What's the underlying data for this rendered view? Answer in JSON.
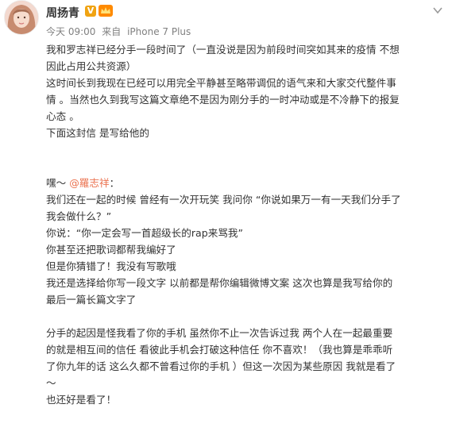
{
  "user": {
    "name": "周扬青",
    "verified_badge": "V",
    "avatar": "avatar-photo"
  },
  "meta": {
    "time": "今天 09:00",
    "source_prefix": "来自",
    "source": "iPhone 7 Plus"
  },
  "lines": [
    "我和罗志祥已经分手一段时间了（一直没说是因为前段时间突如其来的疫情 不想",
    "因此占用公共资源）",
    "这时间长到我现在已经可以用完全平静甚至略带调侃的语气来和大家交代整件事",
    "情 。当然也久到我写这篇文章绝不是因为刚分手的一时冲动或是不冷静下的报复",
    "心态 。",
    "下面这封信 是写给他的",
    "",
    "",
    "我们还在一起的时候 曾经有一次开玩笑 我问你 “你说如果万一有一天我们分手了",
    "我会做什么？”",
    "你说：“你一定会写一首超级长的rap来骂我”",
    "你甚至还把歌词都帮我编好了",
    "但是你猜错了！我没有写歌哦",
    "我还是选择给你写一段文字 以前都是帮你编辑微博文案 这次也算是我写给你的",
    "最后一篇长篇文字了",
    "",
    "分手的起因是怪我看了你的手机 虽然你不止一次告诉过我 两个人在一起最重要",
    "的就是相互间的信任 看彼此手机会打破这种信任 你不喜欢！（我也算是乖乖听",
    "了你九年的话 这么久都不曾看过你的手机 ）但这一次因为某些原因 我就是看了",
    "～",
    "也还好是看了！"
  ],
  "greeting": {
    "prefix": "嘿～ ",
    "mention": "@羅志祥",
    "suffix": "："
  },
  "colors": {
    "mention": "#eb7350",
    "meta": "#808080",
    "text": "#333333"
  }
}
